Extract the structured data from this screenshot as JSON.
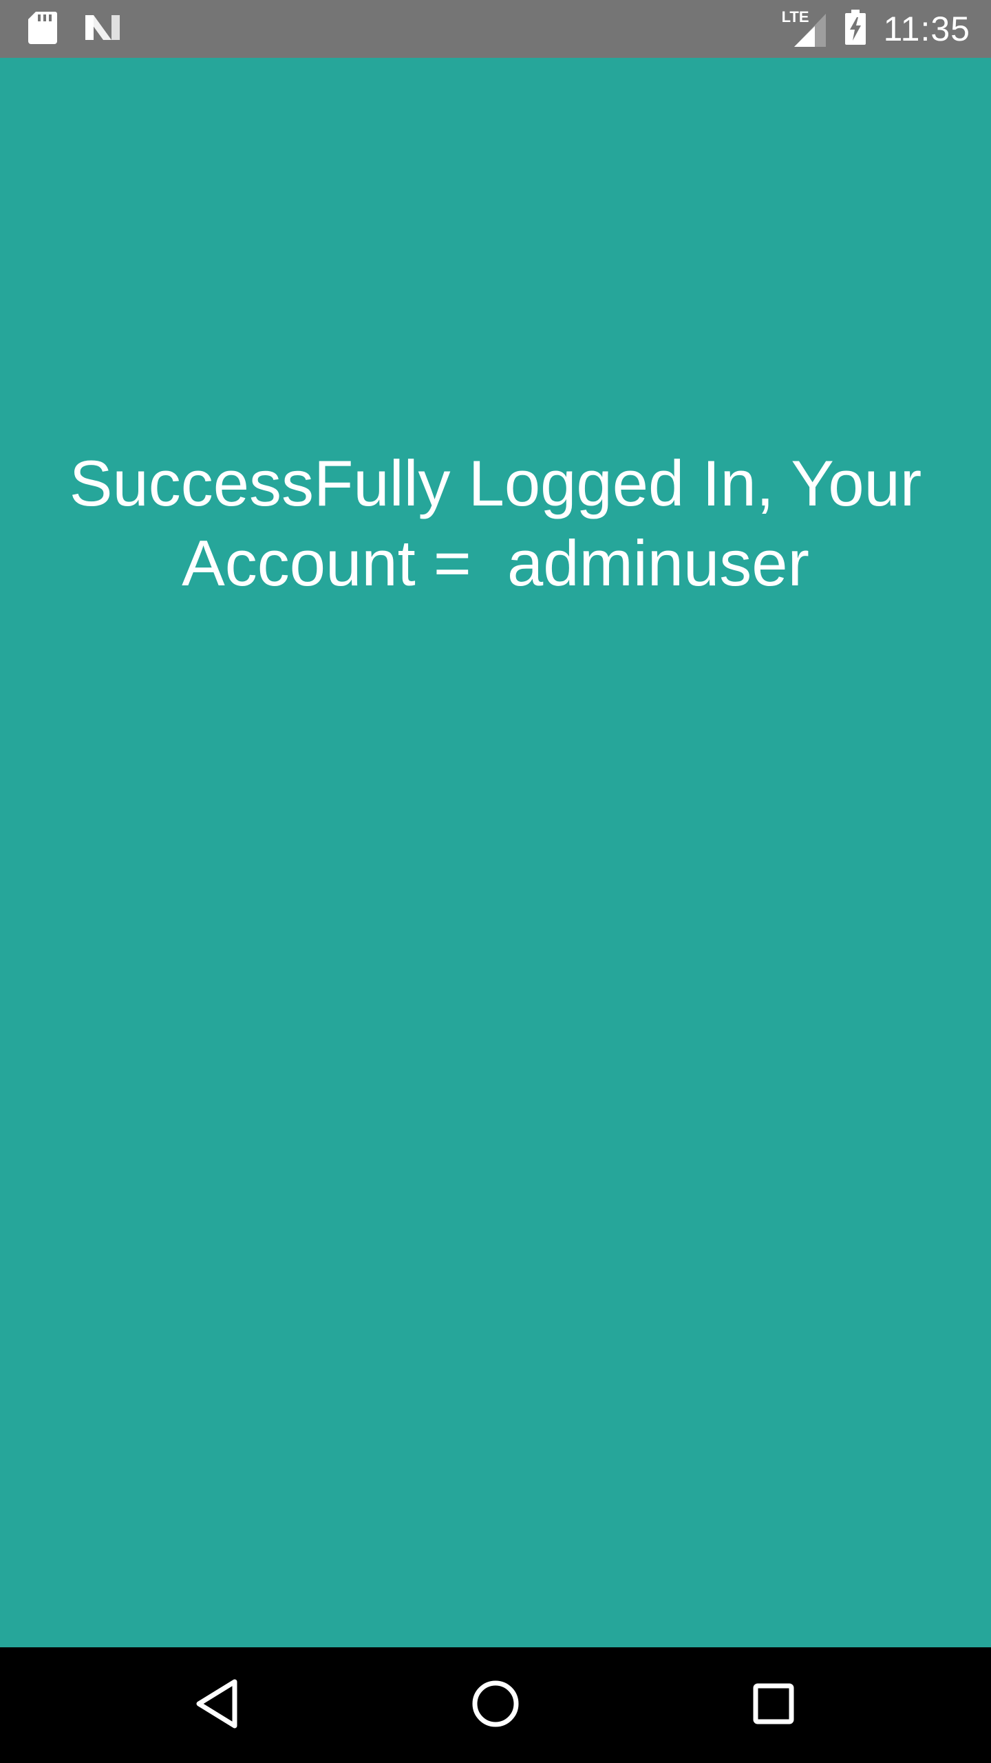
{
  "status_bar": {
    "time": "11:35",
    "network_label": "LTE",
    "icons": [
      "sd-card-icon",
      "android-n-icon",
      "lte-signal-icon",
      "battery-charging-icon"
    ]
  },
  "main": {
    "message": "SuccessFully Logged In, Your\nAccount =  adminuser"
  },
  "nav_bar": {
    "icons": [
      "back-icon",
      "home-icon",
      "recents-icon"
    ]
  },
  "colors": {
    "background": "#26a69a",
    "status_bar": "#757575",
    "nav_bar": "#000000",
    "text": "#ffffff"
  }
}
